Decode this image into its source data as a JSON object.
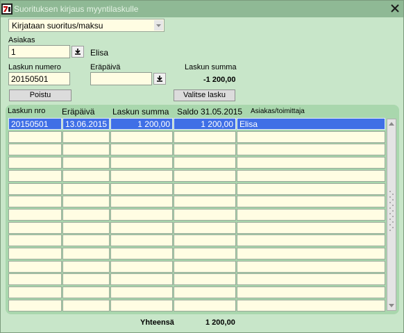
{
  "window": {
    "title": "Suorituksen kirjaus myyntilaskulle",
    "close_icon": "close-icon",
    "app_icon": "app-icon"
  },
  "form": {
    "mode_select": {
      "value": "Kirjataan suoritus/maksu"
    },
    "customer": {
      "label": "Asiakas",
      "value": "1",
      "name": "Elisa"
    },
    "invoice_number": {
      "label": "Laskun numero",
      "value": "20150501"
    },
    "due_date": {
      "label": "Eräpäivä",
      "value": ""
    },
    "invoice_sum": {
      "label": "Laskun summa",
      "value": "-1 200,00"
    }
  },
  "buttons": {
    "exit": "Poistu",
    "select_invoice": "Valitse lasku"
  },
  "table": {
    "headers": [
      "Laskun nro",
      "Eräpäivä",
      "Laskun summa",
      "Saldo 31.05.2015",
      "Asiakas/toimittaja"
    ],
    "rows": [
      [
        "20150501",
        "13.06.2015",
        "1 200,00",
        "1 200,00",
        "Elisa"
      ],
      [
        "",
        "",
        "",
        "",
        ""
      ],
      [
        "",
        "",
        "",
        "",
        ""
      ],
      [
        "",
        "",
        "",
        "",
        ""
      ],
      [
        "",
        "",
        "",
        "",
        ""
      ],
      [
        "",
        "",
        "",
        "",
        ""
      ],
      [
        "",
        "",
        "",
        "",
        ""
      ],
      [
        "",
        "",
        "",
        "",
        ""
      ],
      [
        "",
        "",
        "",
        "",
        ""
      ],
      [
        "",
        "",
        "",
        "",
        ""
      ],
      [
        "",
        "",
        "",
        "",
        ""
      ],
      [
        "",
        "",
        "",
        "",
        ""
      ],
      [
        "",
        "",
        "",
        "",
        ""
      ],
      [
        "",
        "",
        "",
        "",
        ""
      ],
      [
        "",
        "",
        "",
        "",
        ""
      ]
    ],
    "selected_row": 0
  },
  "footer": {
    "total_label": "Yhteensä",
    "total_value": "1 200,00"
  },
  "colors": {
    "window_bg": "#c8e6c9",
    "titlebar": "#8fb995",
    "field_bg": "#fffde3",
    "selection": "#3f6fe6",
    "grid_panel": "#a9d7ad"
  }
}
